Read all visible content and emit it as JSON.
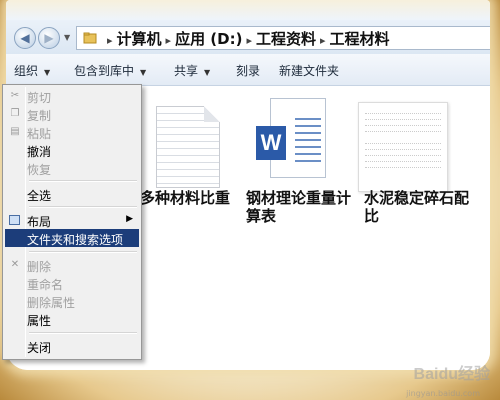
{
  "window": {
    "title": ""
  },
  "address": {
    "crumbs": [
      "计算机",
      "应用 (D:)",
      "工程资料",
      "工程材料"
    ],
    "separator": "▸"
  },
  "toolbar": [
    {
      "label": "组织",
      "has_dropdown": true
    },
    {
      "label": "包含到库中",
      "has_dropdown": true
    },
    {
      "label": "共享",
      "has_dropdown": true
    },
    {
      "label": "刻录",
      "has_dropdown": false
    },
    {
      "label": "新建文件夹",
      "has_dropdown": false
    }
  ],
  "files": [
    {
      "name": "多种材料比重",
      "icon": "text-document-icon"
    },
    {
      "name": "钢材理论重量计算表",
      "icon": "word-document-icon",
      "badge": "W"
    },
    {
      "name": "水泥稳定碎石配比",
      "icon": "document-thumbnail-icon"
    }
  ],
  "menu": {
    "items": [
      {
        "label": "剪切",
        "enabled": false,
        "icon": "cut-icon"
      },
      {
        "label": "复制",
        "enabled": false,
        "icon": "copy-icon"
      },
      {
        "label": "粘贴",
        "enabled": false,
        "icon": "paste-icon"
      },
      {
        "label": "撤消",
        "enabled": true
      },
      {
        "label": "恢复",
        "enabled": false
      },
      {
        "label": "全选",
        "enabled": true
      },
      {
        "label": "布局",
        "enabled": true,
        "submenu": true,
        "icon": "layout-icon"
      },
      {
        "label": "文件夹和搜索选项",
        "enabled": true,
        "selected": true
      },
      {
        "label": "删除",
        "enabled": false,
        "icon": "delete-icon"
      },
      {
        "label": "重命名",
        "enabled": false
      },
      {
        "label": "删除属性",
        "enabled": false
      },
      {
        "label": "属性",
        "enabled": true
      },
      {
        "label": "关闭",
        "enabled": true
      }
    ]
  },
  "colors": {
    "menu_highlight": "#1c3d7a",
    "word_blue": "#2b5aa8"
  },
  "watermark": {
    "text": "Baidu经验",
    "sub": "jingyan.baidu.com"
  }
}
